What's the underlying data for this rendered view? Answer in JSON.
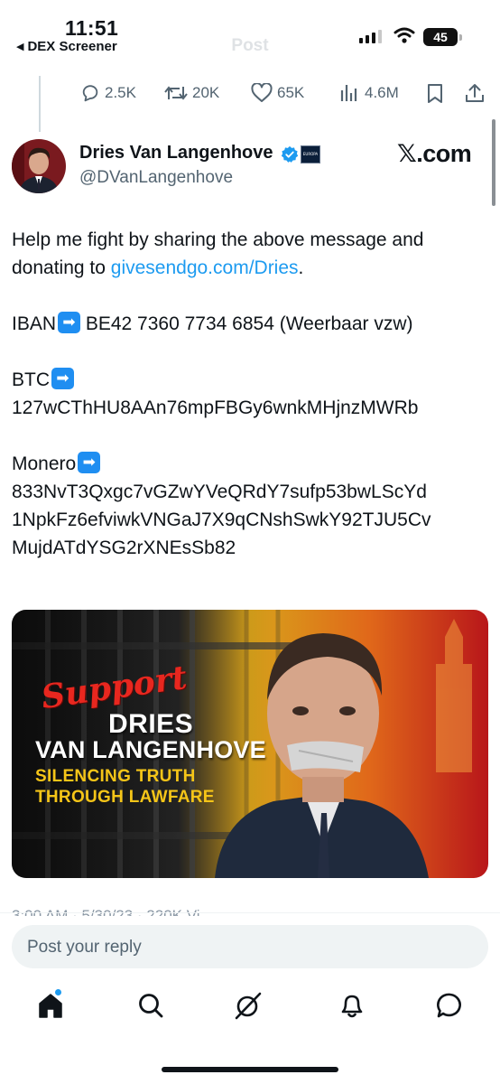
{
  "status_bar": {
    "time": "11:51",
    "back_app": "DEX Screener",
    "battery": "45"
  },
  "nav": {
    "title": "Post"
  },
  "actions": {
    "replies": "2.5K",
    "reposts": "20K",
    "likes": "65K",
    "views": "4.6M"
  },
  "author": {
    "name": "Dries Van Langenhove",
    "handle": "@DVanLangenhove",
    "affiliation_badge": "EUROPA",
    "source": "𝕏.com"
  },
  "post": {
    "line1": "Help me fight by sharing the above message and donating to ",
    "link": "givesendgo.com/Dries",
    "line1_end": ".",
    "iban_label": "IBAN",
    "iban_value": " BE42 7360 7734 6854 (Weerbaar vzw)",
    "btc_label": "BTC",
    "btc_value": "127wCThHU8AAn76mpFBGy6wnkMHjnzMWRb",
    "monero_label": "Monero",
    "monero_value_1": "833NvT3Qxgc7vGZwYVeQRdY7sufp53bwLScYd",
    "monero_value_2": "1NpkFz6efviwkVNGaJ7X9qCNshSwkY92TJU5Cv",
    "monero_value_3": "MujdATdYSG2rXNEsSb82"
  },
  "banner": {
    "support": "Support",
    "dries": "DRIES",
    "van_langenhove": "VAN LANGENHOVE",
    "sub1": "SILENCING TRUTH",
    "sub2": "THROUGH LAWFARE"
  },
  "meta_cut": "3:00 AM · 5/30/23 · 220K Vi",
  "reply": {
    "placeholder": "Post your reply"
  },
  "tabs": [
    "home",
    "search",
    "grok",
    "notifications",
    "messages"
  ],
  "colors": {
    "accent": "#1d9bf0",
    "text": "#0f1419",
    "muted": "#536471"
  }
}
